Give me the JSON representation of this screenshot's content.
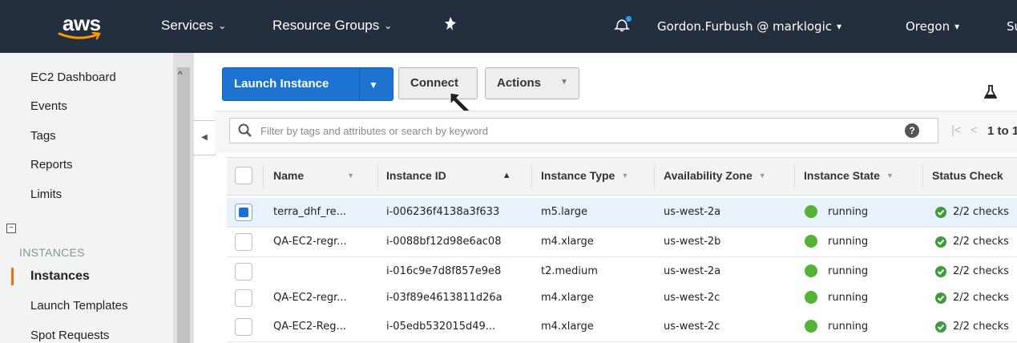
{
  "nav": {
    "logo": "aws",
    "services": "Services",
    "resource_groups": "Resource Groups",
    "user": "Gordon.Furbush @ marklogic",
    "region": "Oregon",
    "support": "Su"
  },
  "sidebar": {
    "items": [
      "EC2 Dashboard",
      "Events",
      "Tags",
      "Reports",
      "Limits"
    ],
    "section_title": "INSTANCES",
    "section_items": [
      "Instances",
      "Launch Templates",
      "Spot Requests"
    ]
  },
  "toolbar": {
    "launch_label": "Launch Instance",
    "connect_label": "Connect",
    "actions_label": "Actions"
  },
  "filter": {
    "placeholder": "Filter by tags and attributes or search by keyword",
    "pager": "1 to 1"
  },
  "table": {
    "columns": [
      "Name",
      "Instance ID",
      "Instance Type",
      "Availability Zone",
      "Instance State",
      "Status Check"
    ],
    "rows": [
      {
        "selected": true,
        "name": "terra_dhf_re...",
        "id": "i-006236f4138a3f633",
        "type": "m5.large",
        "az": "us-west-2a",
        "state": "running",
        "status": "2/2 checks"
      },
      {
        "selected": false,
        "name": "QA-EC2-regr...",
        "id": "i-0088bf12d98e6ac08",
        "type": "m4.xlarge",
        "az": "us-west-2b",
        "state": "running",
        "status": "2/2 checks"
      },
      {
        "selected": false,
        "name": "",
        "id": "i-016c9e7d8f857e9e8",
        "type": "t2.medium",
        "az": "us-west-2a",
        "state": "running",
        "status": "2/2 checks"
      },
      {
        "selected": false,
        "name": "QA-EC2-regr...",
        "id": "i-03f89e4613811d26a",
        "type": "m4.xlarge",
        "az": "us-west-2c",
        "state": "running",
        "status": "2/2 checks"
      },
      {
        "selected": false,
        "name": "QA-EC2-Reg...",
        "id": "i-05edb532015d49...",
        "type": "m4.xlarge",
        "az": "us-west-2c",
        "state": "running",
        "status": "2/2 checks"
      }
    ]
  },
  "colors": {
    "nav_bg": "#232f3e",
    "primary": "#1d73d1",
    "accent": "#ec7211",
    "running": "#54b334"
  }
}
